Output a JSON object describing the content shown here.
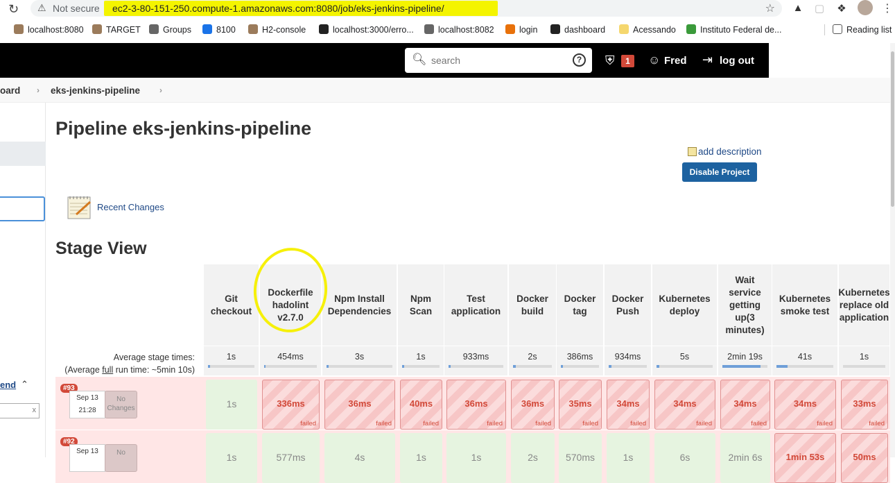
{
  "browser": {
    "not_secure": "Not secure",
    "url": "ec2-3-80-151-250.compute-1.amazonaws.com:8080/job/eks-jenkins-pipeline/",
    "bookmarks": [
      {
        "label": "localhost:8080",
        "color": "#9b7b5b"
      },
      {
        "label": "TARGET",
        "color": "#9b7b5b"
      },
      {
        "label": "Groups",
        "color": "#666666"
      },
      {
        "label": "8100",
        "color": "#1a73e8"
      },
      {
        "label": "H2-console",
        "color": "#9b7b5b"
      },
      {
        "label": "localhost:3000/erro...",
        "color": "#222222"
      },
      {
        "label": "localhost:8082",
        "color": "#666666"
      },
      {
        "label": "login",
        "color": "#e8710a"
      },
      {
        "label": "dashboard",
        "color": "#222222"
      },
      {
        "label": "Acessando",
        "color": "#f5d76e"
      },
      {
        "label": "Instituto Federal de...",
        "color": "#3a9a3a"
      }
    ],
    "reading_list": "Reading list"
  },
  "header": {
    "search_placeholder": "search",
    "help": "?",
    "alert_count": "1",
    "user": "Fred",
    "logout": "log out"
  },
  "breadcrumb": {
    "root": "oard",
    "job": "eks-jenkins-pipeline"
  },
  "sidebar": {
    "trend": "end",
    "filter_clear": "x"
  },
  "main": {
    "title": "Pipeline eks-jenkins-pipeline",
    "add_description": "add description",
    "disable_button": "Disable Project",
    "recent_changes": "Recent Changes",
    "stage_view_title": "Stage View",
    "avg_stage_times": "Average stage times:",
    "avg_full_prefix": "(Average ",
    "avg_full_word": "full",
    "avg_full_suffix": " run time: ~5min 10s)"
  },
  "stages": [
    {
      "name": "Git checkout",
      "avg": "1s",
      "bar": 0.05
    },
    {
      "name": "Dockerfile hadolint v2.7.0",
      "avg": "454ms",
      "bar": 0.02
    },
    {
      "name": "Npm Install Dependencies",
      "avg": "3s",
      "bar": 0.03
    },
    {
      "name": "Npm Scan",
      "avg": "1s",
      "bar": 0.05
    },
    {
      "name": "Test application",
      "avg": "933ms",
      "bar": 0.04
    },
    {
      "name": "Docker build",
      "avg": "2s",
      "bar": 0.08
    },
    {
      "name": "Docker tag",
      "avg": "386ms",
      "bar": 0.06
    },
    {
      "name": "Docker Push",
      "avg": "934ms",
      "bar": 0.08
    },
    {
      "name": "Kubernetes deploy",
      "avg": "5s",
      "bar": 0.05
    },
    {
      "name": "Wait service getting up(3 minutes)",
      "avg": "2min 19s",
      "bar": 0.85
    },
    {
      "name": "Kubernetes smoke test",
      "avg": "41s",
      "bar": 0.2
    },
    {
      "name": "Kubernetes replace old application",
      "avg": "1s",
      "bar": 0.0
    }
  ],
  "builds": [
    {
      "number": "#93",
      "date": "Sep 13",
      "time": "21:28",
      "changes": "No Changes",
      "cells": [
        {
          "value": "1s",
          "status": "ok"
        },
        {
          "value": "336ms",
          "status": "fail"
        },
        {
          "value": "36ms",
          "status": "fail"
        },
        {
          "value": "40ms",
          "status": "fail"
        },
        {
          "value": "36ms",
          "status": "fail"
        },
        {
          "value": "36ms",
          "status": "fail"
        },
        {
          "value": "35ms",
          "status": "fail"
        },
        {
          "value": "34ms",
          "status": "fail"
        },
        {
          "value": "34ms",
          "status": "fail"
        },
        {
          "value": "34ms",
          "status": "fail"
        },
        {
          "value": "34ms",
          "status": "fail"
        },
        {
          "value": "33ms",
          "status": "fail"
        }
      ],
      "failed_label": "failed"
    },
    {
      "number": "#92",
      "date": "Sep 13",
      "changes": "No",
      "cells": [
        {
          "value": "1s",
          "status": "ok"
        },
        {
          "value": "577ms",
          "status": "ok"
        },
        {
          "value": "4s",
          "status": "ok"
        },
        {
          "value": "1s",
          "status": "ok"
        },
        {
          "value": "1s",
          "status": "ok"
        },
        {
          "value": "2s",
          "status": "ok"
        },
        {
          "value": "570ms",
          "status": "ok"
        },
        {
          "value": "1s",
          "status": "ok"
        },
        {
          "value": "6s",
          "status": "ok"
        },
        {
          "value": "2min 6s",
          "status": "ok"
        },
        {
          "value": "1min 53s",
          "status": "fail"
        },
        {
          "value": "50ms",
          "status": "fail"
        }
      ]
    }
  ]
}
